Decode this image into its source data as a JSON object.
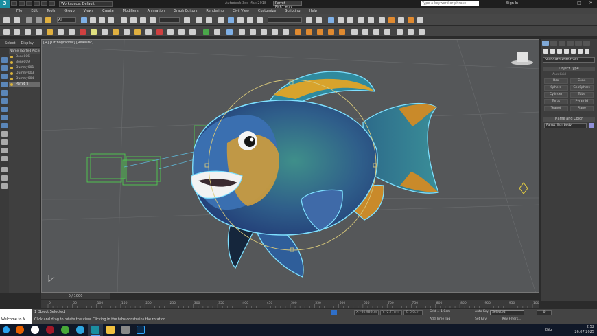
{
  "titlebar": {
    "workspace": "Workspace: Default",
    "title": "Autodesk 3ds Max 2018",
    "file": "Parrot Fish1.max",
    "search_placeholder": "Type a keyword or phrase",
    "signin": "Sign In"
  },
  "menu": [
    "File",
    "Edit",
    "Tools",
    "Group",
    "Views",
    "Create",
    "Modifiers",
    "Animation",
    "Graph Editors",
    "Rendering",
    "Civil View",
    "Customize",
    "Scripting",
    "Help"
  ],
  "toolbar": {
    "selection_filter": "All",
    "named_selection": ""
  },
  "left_panel": {
    "tabs": [
      "Select",
      "Display"
    ],
    "scene_header": "Name (Sorted Ascen",
    "scene_items": [
      {
        "label": "Bone006",
        "selected": false
      },
      {
        "label": "Bone009",
        "selected": false
      },
      {
        "label": "Dummy001",
        "selected": false
      },
      {
        "label": "Dummy003",
        "selected": false
      },
      {
        "label": "Dummy004",
        "selected": false
      },
      {
        "label": "Parrot_fi",
        "selected": true
      }
    ]
  },
  "viewport": {
    "label": "[+] [Orthographic] [Realistic]",
    "progress": "0 / 1000"
  },
  "command_panel": {
    "dropdown": "Standard Primitives",
    "object_type_title": "Object Type",
    "autogrid": "AutoGrid",
    "primitives": [
      "Box",
      "Cone",
      "Sphere",
      "GeoSphere",
      "Cylinder",
      "Tube",
      "Torus",
      "Pyramid",
      "Teapot",
      "Plane"
    ],
    "name_color_title": "Name and Color",
    "object_name": "Parrot_fish_body",
    "object_color": "#9090d8"
  },
  "timeline": {
    "ticks": [
      "0",
      "50",
      "100",
      "150",
      "200",
      "250",
      "300",
      "350",
      "400",
      "450",
      "500",
      "550",
      "600",
      "650",
      "700",
      "750",
      "800",
      "850",
      "900",
      "950",
      "1000"
    ]
  },
  "status": {
    "selection_info": "1 Object Selected",
    "prompt": "Click and drag to rotate the view.  Clicking in the tabs constrains the rotation.",
    "welcome": "Welcome to M",
    "x": "X: -80.986cm",
    "y": "Y: -2.77cm",
    "z": "Z: 0.0cm",
    "grid": "Grid = 1,0cm",
    "add_time_tag": "Add Time Tag",
    "auto_key": "Auto Key",
    "selected": "Selected",
    "set_key": "Set Key",
    "key_filters": "Key Filters...",
    "frame": "0"
  },
  "taskbar": {
    "time": "2:52",
    "date": "26.07.2025",
    "lang": "ENG",
    "apps": [
      {
        "name": "windows-start-icon",
        "color": "#29a3ef"
      },
      {
        "name": "firefox-icon",
        "color": "#e66000"
      },
      {
        "name": "yandex-browser-icon",
        "color": "#ffffff"
      },
      {
        "name": "app-red-icon",
        "color": "#a01828"
      },
      {
        "name": "torrent-icon",
        "color": "#48a838"
      },
      {
        "name": "telegram-icon",
        "color": "#2ea6e0"
      },
      {
        "name": "3dsmax-icon",
        "color": "#1b8ea0"
      },
      {
        "name": "file-explorer-icon",
        "color": "#f0c040"
      },
      {
        "name": "app-gray-icon",
        "color": "#888888"
      },
      {
        "name": "photoshop-icon",
        "color": "#31a8ff"
      }
    ]
  }
}
